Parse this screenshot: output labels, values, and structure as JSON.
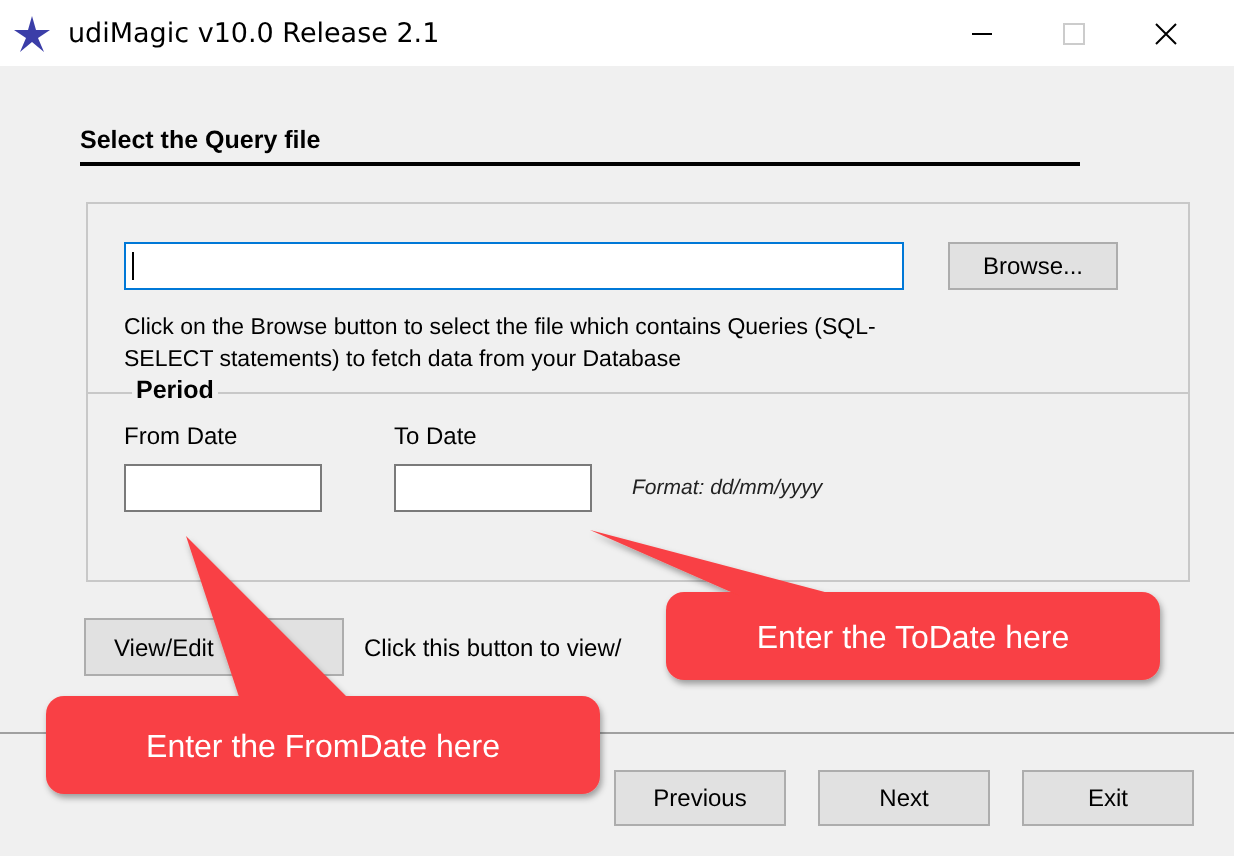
{
  "window": {
    "title": "udiMagic v10.0 Release 2.1"
  },
  "section_title": "Select the Query file",
  "file_field": {
    "focused": true
  },
  "browse_button": "Browse...",
  "file_hint": "Click on the Browse button to select the file which contains Queries (SQL-SELECT statements) to fetch data from your Database",
  "period": {
    "title": "Period",
    "from_label": "From Date",
    "to_label": "To Date",
    "format": "Format: dd/mm/yyyy"
  },
  "view_edit_button": "View/Edit",
  "view_edit_hint": "Click this button to view/",
  "nav_buttons": [
    "Previous",
    "Next",
    "Exit"
  ],
  "callouts": [
    {
      "text": "Enter the ToDate here"
    },
    {
      "text": "Enter the FromDate here"
    }
  ]
}
